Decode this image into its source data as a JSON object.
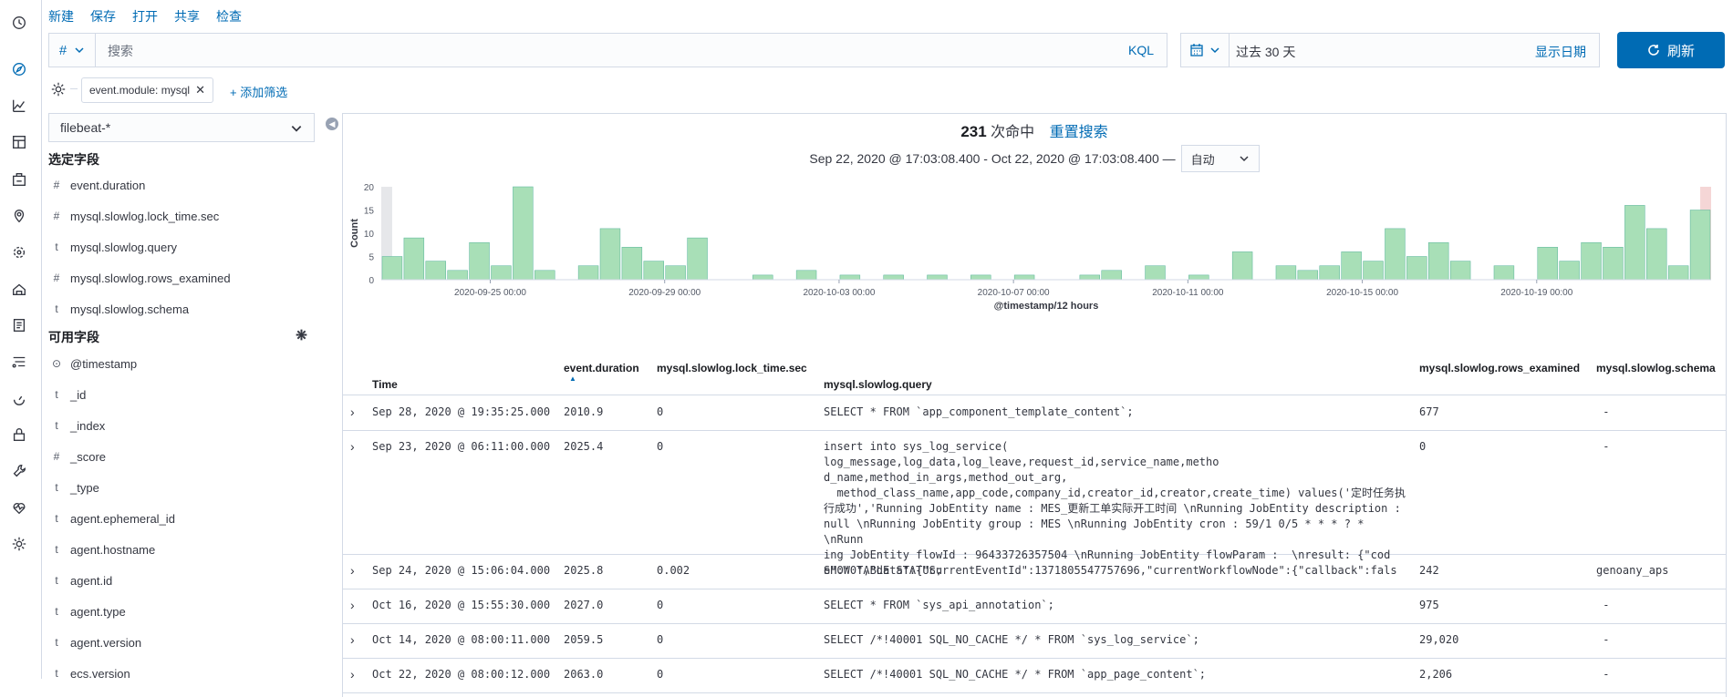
{
  "nav": {
    "icons": [
      "clock-icon",
      "compass-icon",
      "visualize-icon",
      "dashboard-icon",
      "canvas-icon",
      "maps-icon",
      "ml-icon",
      "infrastructure-icon",
      "logs-icon",
      "apm-icon",
      "uptime-icon",
      "siem-icon",
      "dev-tools-icon",
      "monitoring-icon",
      "management-icon"
    ]
  },
  "topmenu": {
    "new": "新建",
    "save": "保存",
    "open": "打开",
    "share": "共享",
    "inspect": "检查"
  },
  "querybar": {
    "hash": "#",
    "placeholder": "搜索",
    "kql": "KQL"
  },
  "datebar": {
    "range": "过去 30 天",
    "show_dates": "显示日期"
  },
  "refresh_label": "刷新",
  "filters": {
    "pill": "event.module: mysql",
    "add": "+ 添加筛选"
  },
  "sidebar": {
    "index_pattern": "filebeat-*",
    "selected_title": "选定字段",
    "selected_fields": [
      {
        "type": "#",
        "name": "event.duration"
      },
      {
        "type": "#",
        "name": "mysql.slowlog.lock_time.sec"
      },
      {
        "type": "t",
        "name": "mysql.slowlog.query"
      },
      {
        "type": "#",
        "name": "mysql.slowlog.rows_examined"
      },
      {
        "type": "t",
        "name": "mysql.slowlog.schema"
      }
    ],
    "available_title": "可用字段",
    "available_fields": [
      {
        "type": "⊙",
        "name": "@timestamp"
      },
      {
        "type": "t",
        "name": "_id"
      },
      {
        "type": "t",
        "name": "_index"
      },
      {
        "type": "#",
        "name": "_score"
      },
      {
        "type": "t",
        "name": "_type"
      },
      {
        "type": "t",
        "name": "agent.ephemeral_id"
      },
      {
        "type": "t",
        "name": "agent.hostname"
      },
      {
        "type": "t",
        "name": "agent.id"
      },
      {
        "type": "t",
        "name": "agent.type"
      },
      {
        "type": "t",
        "name": "agent.version"
      },
      {
        "type": "t",
        "name": "ecs.version"
      }
    ]
  },
  "hits": {
    "count": "231",
    "label": "次命中",
    "reset": "重置搜索"
  },
  "time_range": {
    "text": "Sep 22, 2020 @ 17:03:08.400 - Oct 22, 2020 @ 17:03:08.400 —",
    "interval": "自动"
  },
  "chart_data": {
    "type": "bar",
    "xlabel": "@timestamp/12 hours",
    "ylabel": "Count",
    "ylim": [
      0,
      20
    ],
    "yticks": [
      0,
      5,
      10,
      15,
      20
    ],
    "xticks": [
      "2020-09-25 00:00",
      "2020-09-29 00:00",
      "2020-10-03 00:00",
      "2020-10-07 00:00",
      "2020-10-11 00:00",
      "2020-10-15 00:00",
      "2020-10-19 00:00"
    ],
    "x_start": "2020-09-22 12:00",
    "bucket": "12h",
    "values": [
      5,
      9,
      4,
      2,
      8,
      3,
      20,
      2,
      0,
      3,
      11,
      7,
      4,
      3,
      9,
      0,
      0,
      1,
      0,
      2,
      0,
      1,
      0,
      1,
      0,
      1,
      0,
      1,
      0,
      1,
      0,
      0,
      1,
      2,
      0,
      3,
      0,
      1,
      0,
      6,
      0,
      3,
      2,
      3,
      6,
      4,
      11,
      5,
      8,
      4,
      0,
      3,
      0,
      7,
      4,
      8,
      7,
      16,
      11,
      3,
      15
    ],
    "color": "#a8dfb7",
    "edge_color": "#54b399"
  },
  "table": {
    "headers": {
      "time": "Time",
      "duration": "event.duration",
      "lock": "mysql.slowlog.lock_time.sec",
      "query": "mysql.slowlog.query",
      "rows": "mysql.slowlog.rows_examined",
      "schema": "mysql.slowlog.schema"
    },
    "rows": [
      {
        "time": "Sep 28, 2020 @ 19:35:25.000",
        "duration": "2010.9",
        "lock": "0",
        "query": "SELECT * FROM `app_component_template_content`;",
        "rows": "677",
        "schema": " -"
      },
      {
        "time": "Sep 23, 2020 @ 06:11:00.000",
        "duration": "2025.4",
        "lock": "0",
        "query": "insert into sys_log_service( log_message,log_data,log_leave,request_id,service_name,metho\nd_name,method_in_args,method_out_arg,\n  method_class_name,app_code,company_id,creator_id,creator,create_time) values('定时任务执\n行成功','Running JobEntity name : MES_更新工单实际开工时间 \\nRunning JobEntity description :\nnull \\nRunning JobEntity group : MES \\nRunning JobEntity cron : 59/1 0/5 * * * ? * \\nRunn\ning JobEntity flowId : 96433726357504 \\nRunning JobEntity flowParam :  \\nresult: {\"cod\ne\":\"0\",\"data\":{\"currentEventId\":1371805547757696,\"currentWorkflowNode\":{\"callback\":fals",
        "rows": "0",
        "schema": " -"
      },
      {
        "time": "Sep 24, 2020 @ 15:06:04.000",
        "duration": "2025.8",
        "lock": "0.002",
        "query": "SHOW TABLE STATUS;",
        "rows": "242",
        "schema": "genoany_aps"
      },
      {
        "time": "Oct 16, 2020 @ 15:55:30.000",
        "duration": "2027.0",
        "lock": "0",
        "query": "SELECT * FROM `sys_api_annotation`;",
        "rows": "975",
        "schema": " -"
      },
      {
        "time": "Oct 14, 2020 @ 08:00:11.000",
        "duration": "2059.5",
        "lock": "0",
        "query": "SELECT /*!40001 SQL_NO_CACHE */ * FROM `sys_log_service`;",
        "rows": "29,020",
        "schema": " -"
      },
      {
        "time": "Oct 22, 2020 @ 08:00:12.000",
        "duration": "2063.0",
        "lock": "0",
        "query": "SELECT /*!40001 SQL_NO_CACHE */ * FROM `app_page_content`;",
        "rows": "2,206",
        "schema": " -"
      }
    ]
  }
}
